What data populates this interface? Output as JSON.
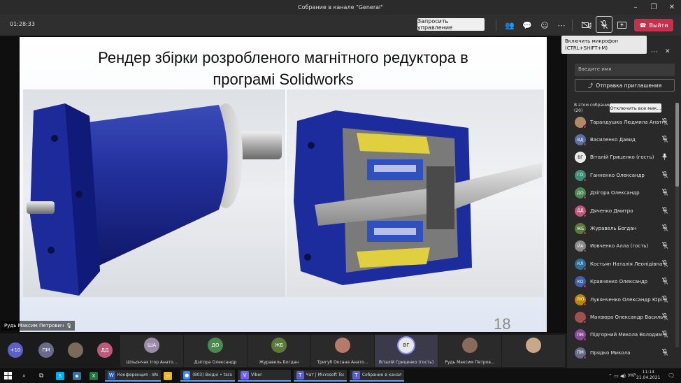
{
  "window": {
    "title": "Собрание в канале \"General\""
  },
  "toolbar": {
    "timer": "01:28:33",
    "request_control": "Запросить управление",
    "leave": "Выйти"
  },
  "tooltip": {
    "line1": "Включить микрофон",
    "line2": "(CTRL+SHIFT+M)"
  },
  "slide": {
    "title_line1": "Рендер збірки розробленого магнітного редуктора в",
    "title_line2": "програмі Solidworks",
    "number": "18",
    "presenter": "Рудь Максим Петрович"
  },
  "panel": {
    "search_placeholder": "Введите имя",
    "invite": "Отправка приглашения",
    "in_meeting": "В этом собрании",
    "count": "(20)",
    "mute_all": "Отключить все мик...",
    "participants": [
      {
        "initials": "",
        "name": "Тарандушка Людмила Анато...",
        "color": "#b08968",
        "photo": true
      },
      {
        "initials": "ВД",
        "name": "Василенко Давид",
        "color": "#5b6ea6"
      },
      {
        "initials": "ВГ",
        "name": "Віталій Гриценко (гость)",
        "color": "#e8e8e8",
        "self": true
      },
      {
        "initials": "ГО",
        "name": "Ганненко Олександр",
        "color": "#3f8f7a"
      },
      {
        "initials": "ДО",
        "name": "Дзігора Олександр",
        "color": "#4a8a52"
      },
      {
        "initials": "ДД",
        "name": "Дяченко Дмитро",
        "color": "#c0587c"
      },
      {
        "initials": "ЖБ",
        "name": "Журавель Богдан",
        "color": "#5a7a3a"
      },
      {
        "initials": "ЙА",
        "name": "Йовченко Алла (гость)",
        "color": "#8a8a8a"
      },
      {
        "initials": "КЛ",
        "name": "Костьян Наталія Леонідівна",
        "color": "#2f6f9f"
      },
      {
        "initials": "КО",
        "name": "Кравченко Олександр",
        "color": "#3f5fa8"
      },
      {
        "initials": "ЛЮ",
        "name": "Лукянченко Олександр Юрі...",
        "color": "#b8860b"
      },
      {
        "initials": "",
        "name": "Манзюра Олександр Василь...",
        "color": "#a05050",
        "photo": true
      },
      {
        "initials": "ПМ",
        "name": "Підгорний Микола Володим...",
        "color": "#8a4a9a"
      },
      {
        "initials": "ПМ",
        "name": "Прядко Микола",
        "color": "#6a6a8a"
      }
    ]
  },
  "strip": {
    "more": "+10",
    "avatars": [
      {
        "initials": "ПМ",
        "color": "#6a6a8a"
      },
      {
        "initials": "",
        "color": "#7a6a5a",
        "photo": true
      },
      {
        "initials": "ДД",
        "color": "#c0587c"
      }
    ],
    "tiles": [
      {
        "initials": "ША",
        "name": "Шльончак Ігор Анато...",
        "color": "#9a8aa8"
      },
      {
        "initials": "ДО",
        "name": "Дзігора Олександр",
        "color": "#4a8a52"
      },
      {
        "initials": "ЖБ",
        "name": "Журавель Богдан",
        "color": "#5a7a3a"
      },
      {
        "initials": "",
        "name": "Тригуб Оксана Анато...",
        "color": "#b57a6a",
        "photo": true
      },
      {
        "initials": "ВГ",
        "name": "Віталій Гриценко (гость)",
        "color": "#e8e8e8",
        "self": true
      },
      {
        "initials": "",
        "name": "Рудь Максим Петров...",
        "color": "#8a6a5a",
        "photo": true
      },
      {
        "initials": "",
        "name": "",
        "color": "#c8a888",
        "photo": true
      }
    ]
  },
  "taskbar": {
    "apps": [
      {
        "label": "Конференция - Word",
        "icon": "W",
        "color": "#2b579a"
      },
      {
        "label": "(803) Вхідні • taran...",
        "icon": "●",
        "color": "#4285f4"
      },
      {
        "label": "Viber",
        "icon": "V",
        "color": "#7360f2"
      },
      {
        "label": "Чат | Microsoft Tea...",
        "icon": "T",
        "color": "#5b5fc7"
      },
      {
        "label": "Собрание в канал...",
        "icon": "T",
        "color": "#5b5fc7"
      }
    ],
    "lang": "УКР",
    "time": "11:14",
    "date": "21.04.2021"
  }
}
